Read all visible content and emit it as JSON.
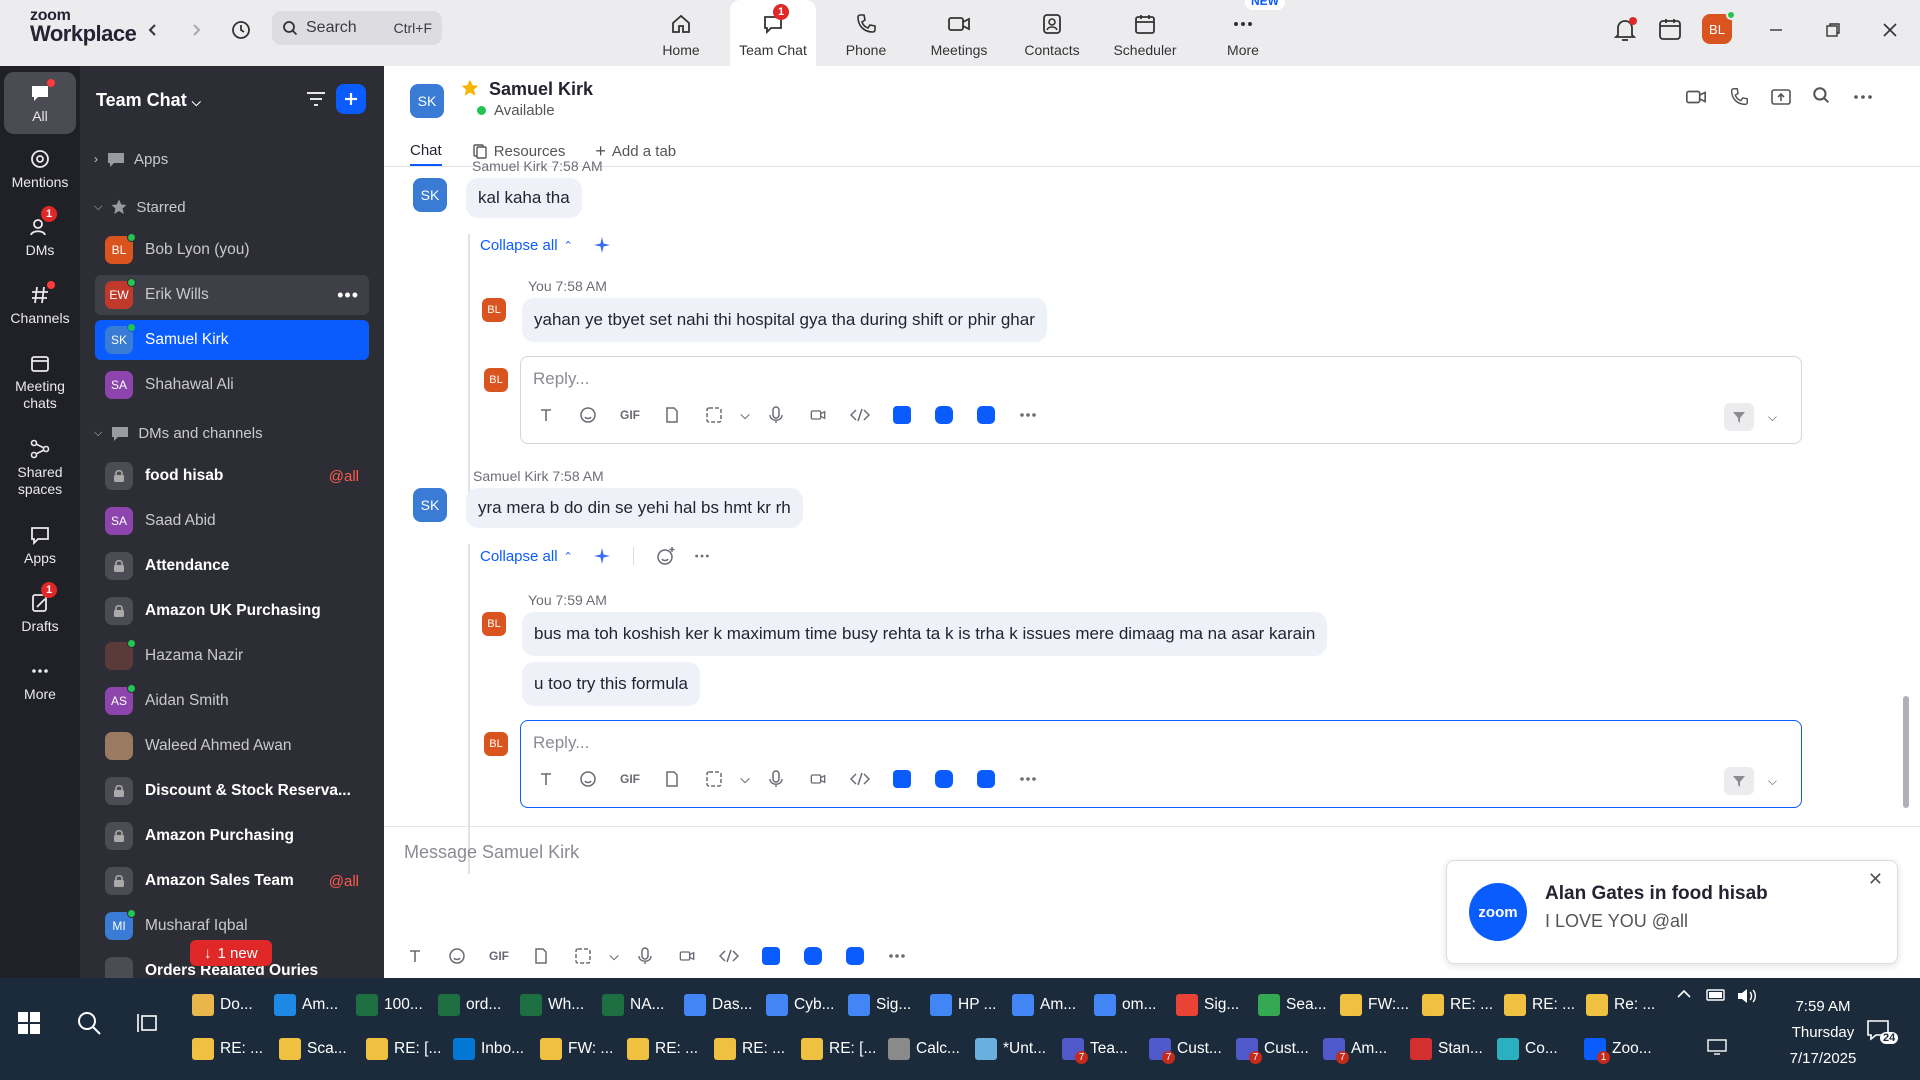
{
  "app": {
    "logo_line1": "zoom",
    "logo_line2": "Workplace"
  },
  "search": {
    "placeholder": "Search",
    "shortcut": "Ctrl+F"
  },
  "nav_tabs": [
    {
      "label": "Home",
      "icon": "home-icon"
    },
    {
      "label": "Team Chat",
      "icon": "chat-icon",
      "badge": "1",
      "active": true
    },
    {
      "label": "Phone",
      "icon": "phone-icon"
    },
    {
      "label": "Meetings",
      "icon": "video-icon"
    },
    {
      "label": "Contacts",
      "icon": "contacts-icon"
    },
    {
      "label": "Scheduler",
      "icon": "calendar-icon"
    },
    {
      "label": "More",
      "icon": "more-icon",
      "new_badge": "NEW"
    }
  ],
  "profile": {
    "initials": "BL",
    "avatar_color": "#d9541e"
  },
  "rail": [
    {
      "label": "All"
    },
    {
      "label": "Mentions"
    },
    {
      "label": "DMs",
      "badge": "1"
    },
    {
      "label": "Channels"
    },
    {
      "label": "Meeting chats"
    },
    {
      "label": "Shared spaces"
    },
    {
      "label": "Apps"
    },
    {
      "label": "Drafts",
      "badge": "1"
    },
    {
      "label": "More"
    }
  ],
  "sidebar": {
    "title": "Team Chat",
    "apps_label": "Apps",
    "starred_label": "Starred",
    "dms_label": "DMs and channels",
    "starred": [
      {
        "name": "Bob Lyon (you)",
        "initials": "BL",
        "color": "#d9541e"
      },
      {
        "name": "Erik Wills",
        "initials": "EW",
        "color": "#c0392b"
      },
      {
        "name": "Samuel Kirk",
        "initials": "SK",
        "color": "#3a7bd5"
      },
      {
        "name": "Shahawal Ali",
        "initials": "SA",
        "color": "#8e44ad"
      }
    ],
    "channels": [
      {
        "name": "food hisab",
        "mention": "@all"
      },
      {
        "name": "Saad Abid",
        "initials": "SA",
        "color": "#8e44ad"
      },
      {
        "name": "Attendance"
      },
      {
        "name": "Amazon UK Purchasing"
      },
      {
        "name": "Hazama Nazir",
        "initials": "",
        "color": "#5b3a3a"
      },
      {
        "name": "Aidan Smith",
        "initials": "AS",
        "color": "#8e44ad"
      },
      {
        "name": "Waleed Ahmed Awan",
        "initials": "",
        "color": "#9a7a60"
      },
      {
        "name": "Discount & Stock Reserva..."
      },
      {
        "name": "Amazon Purchasing"
      },
      {
        "name": "Amazon Sales Team",
        "mention": "@all"
      },
      {
        "name": "Musharaf Iqbal",
        "initials": "MI",
        "color": "#3a7bd5"
      },
      {
        "name": "Orders Realated Ouries"
      }
    ],
    "new_pill": "1 new"
  },
  "chat": {
    "contact_name": "Samuel Kirk",
    "contact_initials": "SK",
    "contact_status": "Available",
    "tabs": [
      "Chat",
      "Resources",
      "Add a tab"
    ],
    "top_meta": "Samuel Kirk 7:58 AM",
    "messages": {
      "m1_text": "kal kaha tha",
      "collapse_label": "Collapse all",
      "r1_meta": "You 7:58 AM",
      "r1_text": "yahan ye tbyet set nahi thi hospital gya tha during shift or phir ghar",
      "reply_placeholder": "Reply...",
      "m2_meta": "Samuel Kirk 7:58 AM",
      "m2_text": "yra mera b do din se yehi hal bs hmt kr rh",
      "r2_meta": "You 7:59 AM",
      "r2_text": "bus ma toh koshish ker k maximum time busy rehta ta k is trha k issues mere dimaag ma na asar karain",
      "r3_text": "u too try this formula"
    },
    "composer_placeholder": "Message Samuel Kirk",
    "toolbar_gif": "GIF"
  },
  "toast": {
    "logo": "zoom",
    "title": "Alan Gates in food hisab",
    "body": "I LOVE YOU @all"
  },
  "taskbar": {
    "row1": [
      {
        "label": "Do...",
        "color": "#e8b64a"
      },
      {
        "label": "Am...",
        "color": "#1e88e5"
      },
      {
        "label": "100...",
        "color": "#1d6f42"
      },
      {
        "label": "ord...",
        "color": "#1d6f42"
      },
      {
        "label": "Wh...",
        "color": "#1d6f42"
      },
      {
        "label": "NA...",
        "color": "#1d6f42"
      },
      {
        "label": "Das...",
        "color": "#4285f4"
      },
      {
        "label": "Cyb...",
        "color": "#4285f4"
      },
      {
        "label": "Sig...",
        "color": "#4285f4"
      },
      {
        "label": "HP ...",
        "color": "#4285f4"
      },
      {
        "label": "Am...",
        "color": "#4285f4"
      },
      {
        "label": "om...",
        "color": "#4285f4"
      },
      {
        "label": "Sig...",
        "color": "#ea4335"
      },
      {
        "label": "Sea...",
        "color": "#34a853"
      },
      {
        "label": "FW:...",
        "color": "#f0c040"
      },
      {
        "label": "RE: ...",
        "color": "#f0c040"
      },
      {
        "label": "RE: ...",
        "color": "#f0c040"
      },
      {
        "label": "Re: ...",
        "color": "#f0c040"
      }
    ],
    "row2": [
      {
        "label": "RE: ...",
        "color": "#f0c040"
      },
      {
        "label": "Sca...",
        "color": "#f0c040"
      },
      {
        "label": "RE: [...",
        "color": "#f0c040"
      },
      {
        "label": "Inbo...",
        "color": "#0078d4"
      },
      {
        "label": "FW: ...",
        "color": "#f0c040"
      },
      {
        "label": "RE: ...",
        "color": "#f0c040"
      },
      {
        "label": "RE: ...",
        "color": "#f0c040"
      },
      {
        "label": "RE: [...",
        "color": "#f0c040"
      },
      {
        "label": "Calc...",
        "color": "#8a8a8a"
      },
      {
        "label": "*Unt...",
        "color": "#6ab0de"
      },
      {
        "label": "Tea...",
        "color": "#5059c9",
        "count": "7"
      },
      {
        "label": "Cust...",
        "color": "#5059c9",
        "count": "7"
      },
      {
        "label": "Cust...",
        "color": "#5059c9",
        "count": "7"
      },
      {
        "label": "Am...",
        "color": "#5059c9",
        "count": "7"
      },
      {
        "label": "Stan...",
        "color": "#d32f2f"
      },
      {
        "label": "Co...",
        "color": "#2bb0c0"
      },
      {
        "label": "Zoo...",
        "color": "#0b5cff",
        "count": "1"
      }
    ],
    "time": "7:59 AM",
    "day": "Thursday",
    "date": "7/17/2025",
    "notif_count": "24"
  }
}
